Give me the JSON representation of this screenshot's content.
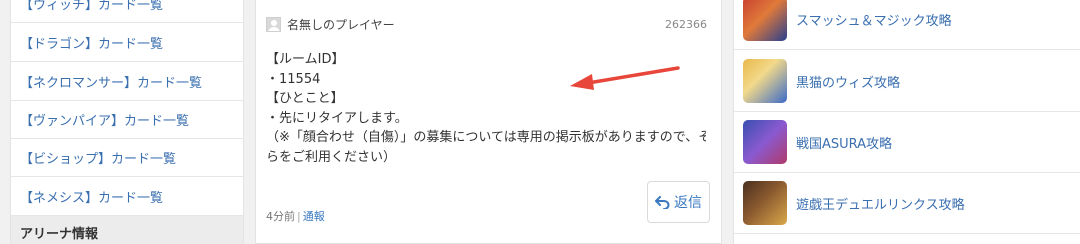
{
  "sidebar": {
    "items": [
      {
        "label": "【ウィッチ】カード一覧"
      },
      {
        "label": "【ドラゴン】カード一覧"
      },
      {
        "label": "【ネクロマンサー】カード一覧"
      },
      {
        "label": "【ヴァンパイア】カード一覧"
      },
      {
        "label": "【ビショップ】カード一覧"
      },
      {
        "label": "【ネメシス】カード一覧"
      }
    ],
    "section_label": "アリーナ情報"
  },
  "comment": {
    "username": "名無しのプレイヤー",
    "id": "262366",
    "lines": [
      "【ルームID】",
      "・11554",
      "【ひとこと】",
      "・先にリタイアします。",
      "（※「顔合わせ（自傷）」の募集については専用の掲示板がありますので、そちら",
      "らをご利用ください）"
    ],
    "reply_label": "返信",
    "reply_icon": "reply-arrow-icon",
    "time": "4分前",
    "separator": "|",
    "report_label": "通報",
    "accent_color": "#3a78c0",
    "arrow_color": "#e8463a"
  },
  "games": [
    {
      "name": "スマッシュ＆マジック攻略",
      "colors": [
        "#c8412f",
        "#2a3f8f"
      ]
    },
    {
      "name": "黒猫のウィズ攻略",
      "colors": [
        "#e8b84a",
        "#3a6ac8"
      ]
    },
    {
      "name": "戦国ASURA攻略",
      "colors": [
        "#3a4fb0",
        "#b03a6a"
      ]
    },
    {
      "name": "遊戯王デュエルリンクス攻略",
      "colors": [
        "#4a2f1f",
        "#d9a84a"
      ]
    }
  ]
}
